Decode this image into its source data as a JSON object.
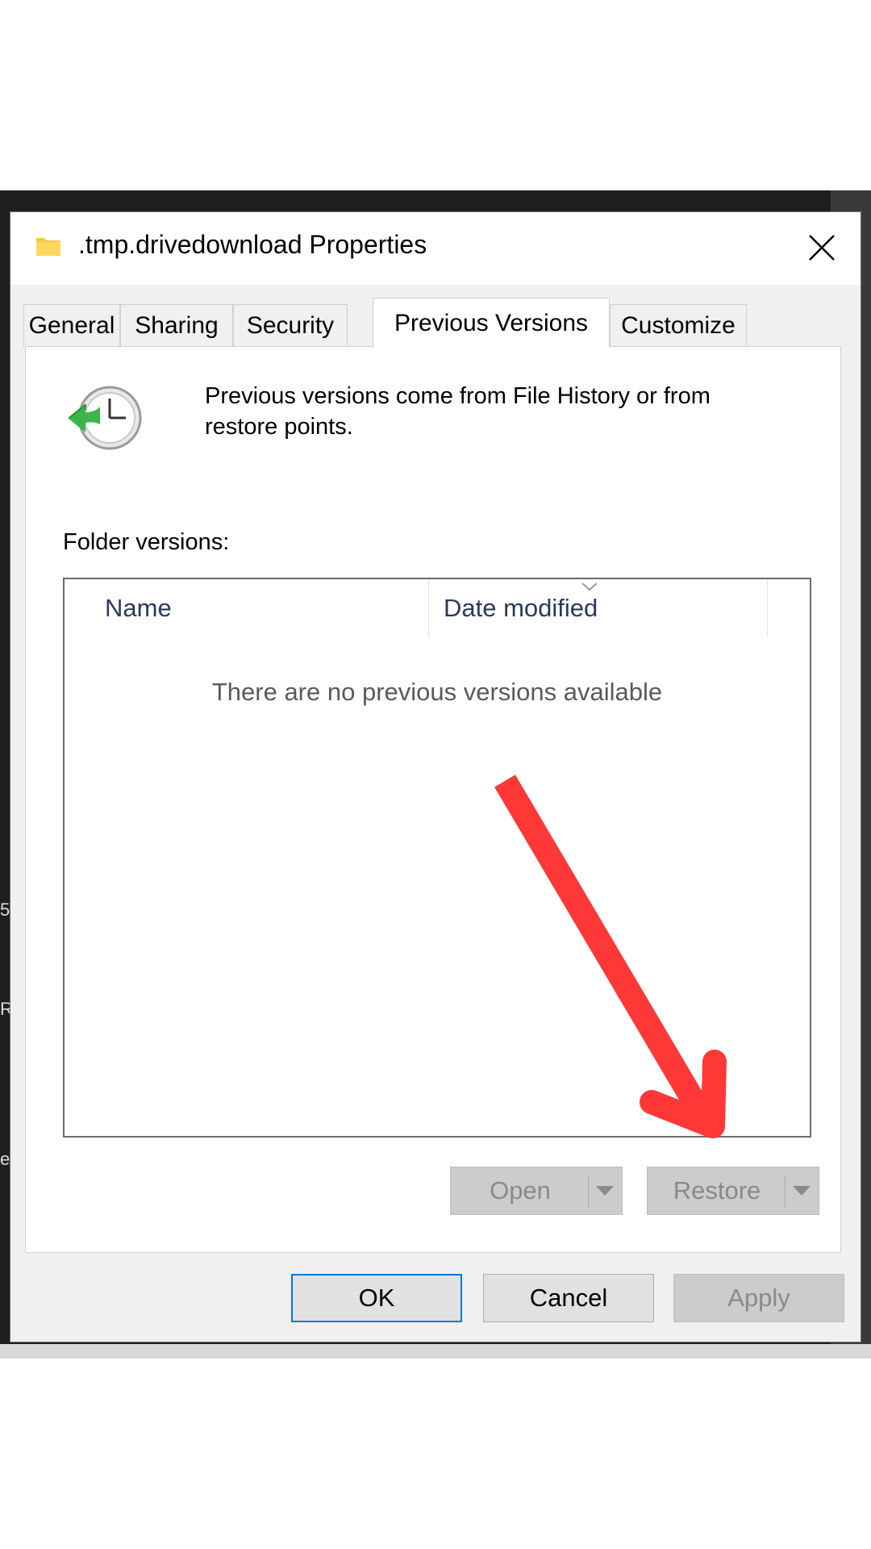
{
  "background": {
    "window_color": "#1e1e1e",
    "edge_chars": [
      "5",
      "R",
      "e"
    ]
  },
  "dialog": {
    "title": ".tmp.drivedownload Properties",
    "title_icon": "folder-icon",
    "close_icon": "close-icon"
  },
  "tabs": [
    {
      "label": "General",
      "active": false
    },
    {
      "label": "Sharing",
      "active": false
    },
    {
      "label": "Security",
      "active": false
    },
    {
      "label": "Previous Versions",
      "active": true
    },
    {
      "label": "Customize",
      "active": false
    }
  ],
  "panel": {
    "icon": "restore-history-icon",
    "description": "Previous versions come from File History or from restore points.",
    "folder_versions_label": "Folder versions:",
    "list": {
      "columns": [
        "Name",
        "Date modified"
      ],
      "sorted_column": "Date modified",
      "empty_message": "There are no previous versions available"
    },
    "buttons": {
      "open": "Open",
      "restore": "Restore",
      "open_enabled": false,
      "restore_enabled": false
    }
  },
  "footer": {
    "ok": "OK",
    "cancel": "Cancel",
    "apply": "Apply",
    "apply_enabled": false
  },
  "annotation": {
    "type": "arrow",
    "color": "#ff3333",
    "points_to": "restore-button"
  }
}
